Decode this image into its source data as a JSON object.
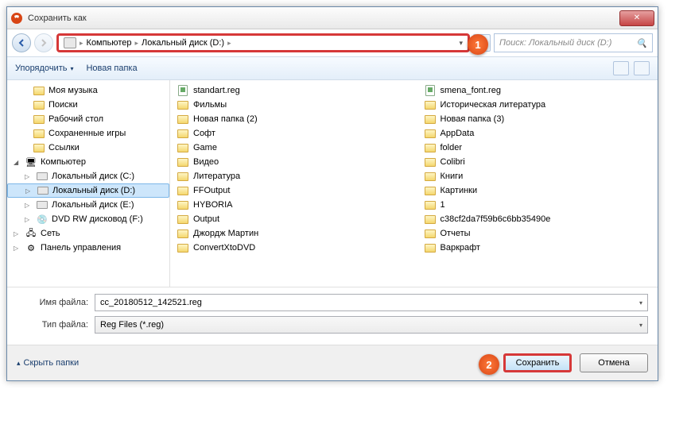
{
  "title": "Сохранить как",
  "breadcrumb": {
    "root": "Компьютер",
    "drive": "Локальный диск (D:)"
  },
  "search_placeholder": "Поиск: Локальный диск (D:)",
  "toolbar": {
    "organize": "Упорядочить",
    "newfolder": "Новая папка"
  },
  "tree": {
    "mymusic": "Моя музыка",
    "searches": "Поиски",
    "desktop": "Рабочий стол",
    "savedgames": "Сохраненные игры",
    "links": "Ссылки",
    "computer": "Компьютер",
    "driveC": "Локальный диск (C:)",
    "driveD": "Локальный диск (D:)",
    "driveE": "Локальный диск (E:)",
    "dvd": "DVD RW дисковод (F:)",
    "network": "Сеть",
    "controlpanel": "Панель управления"
  },
  "files_col1": [
    {
      "t": "reg",
      "n": "standart.reg"
    },
    {
      "t": "f",
      "n": "Фильмы"
    },
    {
      "t": "f",
      "n": "Новая папка (2)"
    },
    {
      "t": "f",
      "n": "Софт"
    },
    {
      "t": "f",
      "n": "Game"
    },
    {
      "t": "f",
      "n": "Видео"
    },
    {
      "t": "f",
      "n": "Литература"
    },
    {
      "t": "f",
      "n": "FFOutput"
    },
    {
      "t": "f",
      "n": "HYBORIA"
    },
    {
      "t": "f",
      "n": "Output"
    },
    {
      "t": "f",
      "n": "Джордж Мартин"
    },
    {
      "t": "f",
      "n": "ConvertXtoDVD"
    }
  ],
  "files_col2": [
    {
      "t": "reg",
      "n": "smena_font.reg"
    },
    {
      "t": "f",
      "n": "Историческая литература"
    },
    {
      "t": "f",
      "n": "Новая папка (3)"
    },
    {
      "t": "f",
      "n": "AppData"
    },
    {
      "t": "f",
      "n": "folder"
    },
    {
      "t": "f",
      "n": "Colibri"
    },
    {
      "t": "f",
      "n": "Книги"
    },
    {
      "t": "f",
      "n": "Картинки"
    },
    {
      "t": "f",
      "n": "1"
    },
    {
      "t": "f",
      "n": "c38cf2da7f59b6c6bb35490e"
    },
    {
      "t": "f",
      "n": "Отчеты"
    },
    {
      "t": "f",
      "n": "Варкрафт"
    }
  ],
  "filename_label": "Имя файла:",
  "filename_value": "cc_20180512_142521.reg",
  "filetype_label": "Тип файла:",
  "filetype_value": "Reg Files (*.reg)",
  "hide_folders": "Скрыть папки",
  "save": "Сохранить",
  "cancel": "Отмена",
  "callout1": "1",
  "callout2": "2"
}
